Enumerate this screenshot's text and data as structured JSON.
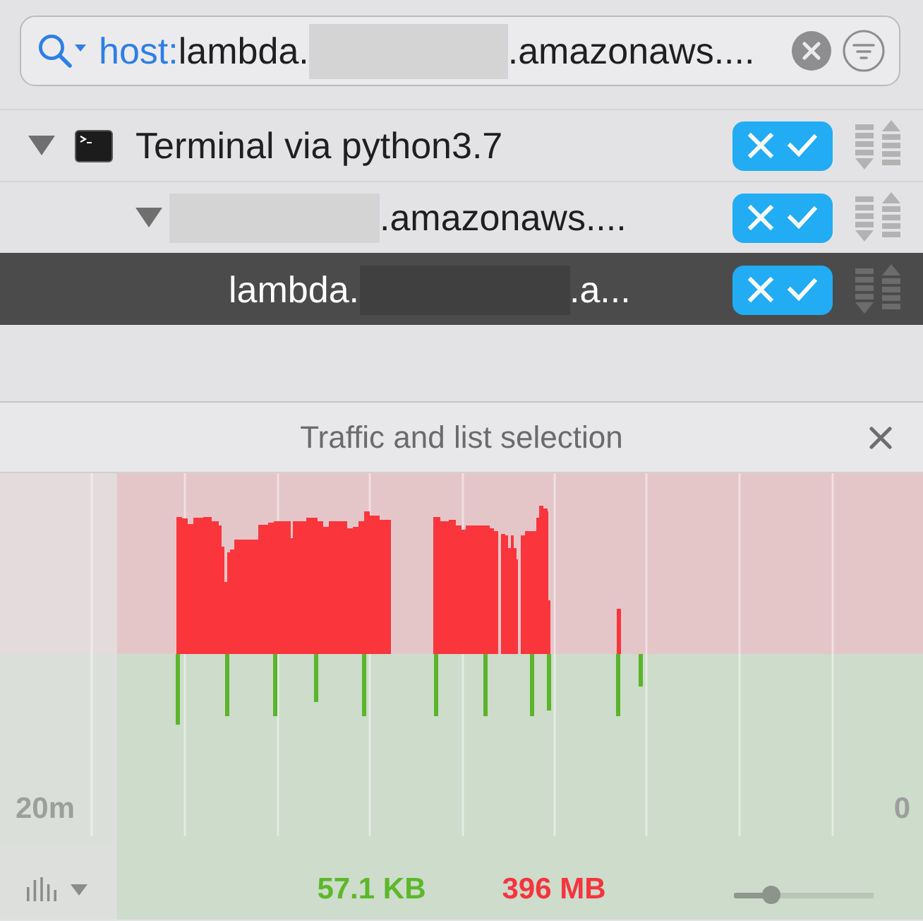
{
  "search": {
    "filter_key": "host:",
    "value": [
      {
        "kind": "text",
        "text": "lambda."
      },
      {
        "kind": "redacted"
      },
      {
        "kind": "text",
        "text": ".amazonaws...."
      }
    ]
  },
  "rules": [
    {
      "kind": "app",
      "label": [
        {
          "kind": "text",
          "text": "Terminal via python3.7"
        }
      ],
      "expanded": true,
      "selected": false,
      "children": [
        {
          "kind": "host",
          "label": [
            {
              "kind": "redacted"
            },
            {
              "kind": "text",
              "text": ".amazonaws...."
            }
          ],
          "expanded": true,
          "selected": false,
          "children": [
            {
              "kind": "host",
              "label": [
                {
                  "kind": "text",
                  "text": "lambda."
                },
                {
                  "kind": "redacted"
                },
                {
                  "kind": "text",
                  "text": ".a..."
                }
              ],
              "selected": true
            }
          ]
        }
      ]
    }
  ],
  "traffic_panel": {
    "title": "Traffic and list selection",
    "time_axis_labels": [
      "20m",
      "0"
    ],
    "totals": [
      {
        "text": "57.1 KB",
        "color": "#5cb82a"
      },
      {
        "text": "396 MB",
        "color": "#f6343e"
      }
    ],
    "zoom_slider": {
      "level": 0.27
    }
  }
}
